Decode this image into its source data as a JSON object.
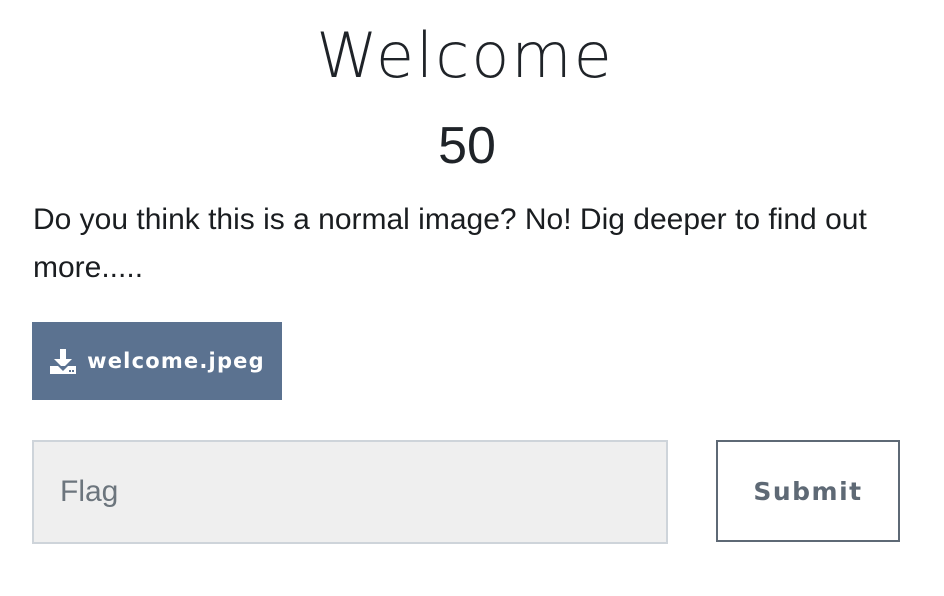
{
  "challenge": {
    "name": "Welcome",
    "value": "50",
    "description": "Do you think this is a normal image? No! Dig deeper to find out more.....",
    "file": {
      "icon": "download-icon",
      "name": "welcome.jpeg"
    },
    "submission": {
      "placeholder": "Flag",
      "value": "",
      "submit_label": "Submit"
    }
  },
  "colors": {
    "download_button_bg": "#5b7290",
    "submit_border": "#5e6975",
    "input_bg": "#efefef"
  }
}
